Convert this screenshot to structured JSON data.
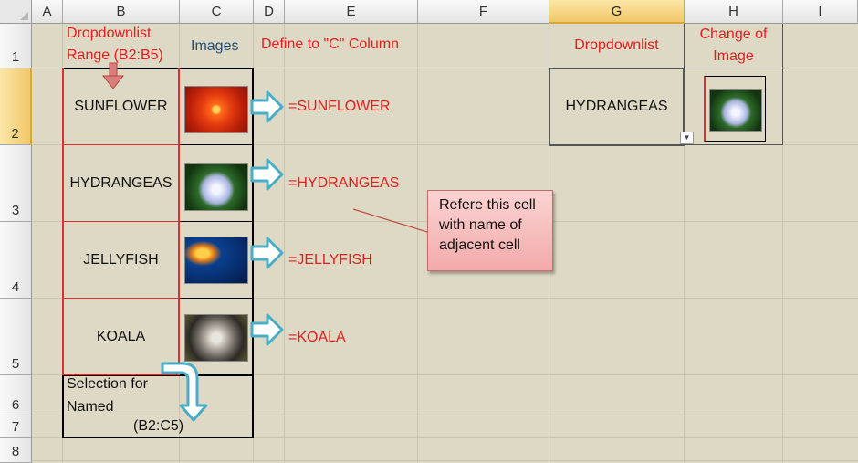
{
  "columns": [
    "A",
    "B",
    "C",
    "D",
    "E",
    "F",
    "G",
    "H",
    "I"
  ],
  "rows": [
    "1",
    "2",
    "3",
    "4",
    "5",
    "6",
    "7",
    "8"
  ],
  "header": {
    "dropdownlist_range_line1": "Dropdownlist",
    "dropdownlist_range_line2": "Range  (B2:B5)",
    "images": "Images",
    "define_to_c": "Define to \"C\" Column",
    "dropdownlist": "Dropdownlist",
    "change_of_image": "Change of\nImage"
  },
  "list_items": [
    "SUNFLOWER",
    "HYDRANGEAS",
    "JELLYFISH",
    "KOALA"
  ],
  "formulas": [
    "=SUNFLOWER",
    "=HYDRANGEAS",
    "=JELLYFISH",
    "=KOALA"
  ],
  "selection_text_line1": "Selection for",
  "selection_text_line2": "Named",
  "selection_text_line3": "(B2:C5)",
  "dropdown_value": "HYDRANGEAS",
  "note_text": "Refere this cell\nwith name of\nadjacent cell",
  "dropdown_arrow": "▼",
  "colors": {
    "accent_red": "#e01e1e",
    "arrow_blue": "#4bacc6",
    "sheet_bg": "#ddd9c4",
    "selected_header": "#f1c869"
  }
}
